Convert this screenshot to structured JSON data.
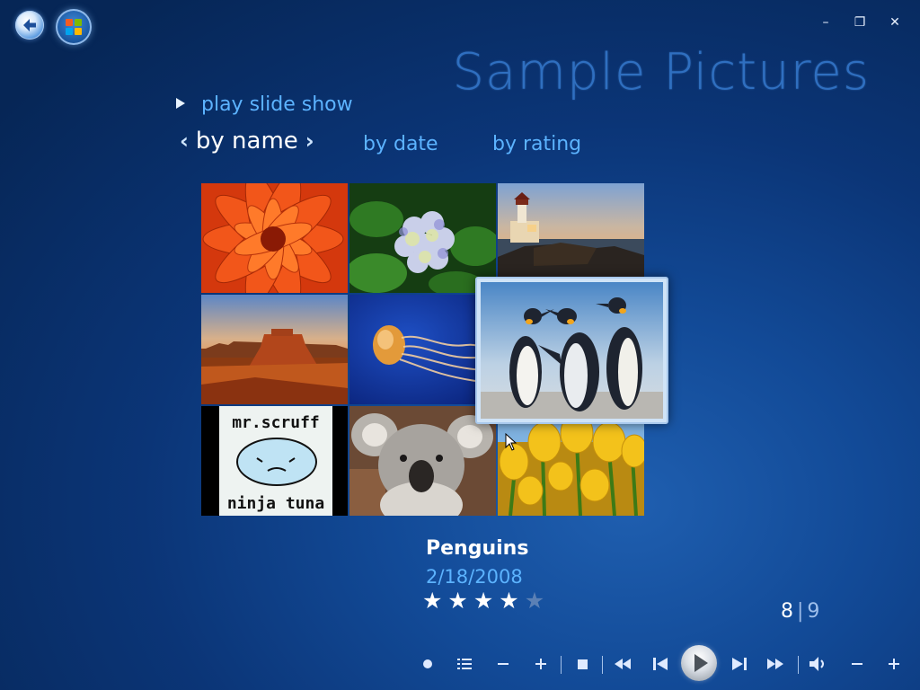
{
  "window": {
    "title": "Sample Pictures",
    "controls": {
      "minimize": "–",
      "restore": "❐",
      "close": "✕"
    }
  },
  "actions": {
    "play_slide_show": "play slide show"
  },
  "sort": {
    "active": "by name",
    "options": [
      "by date",
      "by rating"
    ]
  },
  "thumbnails": [
    {
      "icon": "chrysanthemum-thumb"
    },
    {
      "icon": "hydrangeas-thumb"
    },
    {
      "icon": "lighthouse-thumb"
    },
    {
      "icon": "desert-thumb"
    },
    {
      "icon": "jellyfish-thumb"
    },
    {
      "icon": "penguins-thumb"
    },
    {
      "icon": "mr-scruff-thumb",
      "text_top": "mr.scruff",
      "text_bottom": "ninja tuna"
    },
    {
      "icon": "koala-thumb"
    },
    {
      "icon": "tulips-thumb"
    }
  ],
  "selected": {
    "name": "Penguins",
    "date": "2/18/2008",
    "rating": 4,
    "rating_max": 5,
    "star": "★"
  },
  "counter": {
    "current": "8",
    "separator": "|",
    "total": "9"
  },
  "transport": {
    "icons": [
      "record-icon",
      "guide-list-icon",
      "channel-down-icon",
      "channel-up-icon",
      "stop-icon",
      "rewind-icon",
      "previous-icon",
      "play-icon",
      "next-icon",
      "fast-forward-icon",
      "mute-icon",
      "volume-down-icon",
      "volume-up-icon"
    ]
  },
  "colors": {
    "accent": "#5cb3ff",
    "title": "#2f6fc0",
    "background": "#0b3577"
  }
}
